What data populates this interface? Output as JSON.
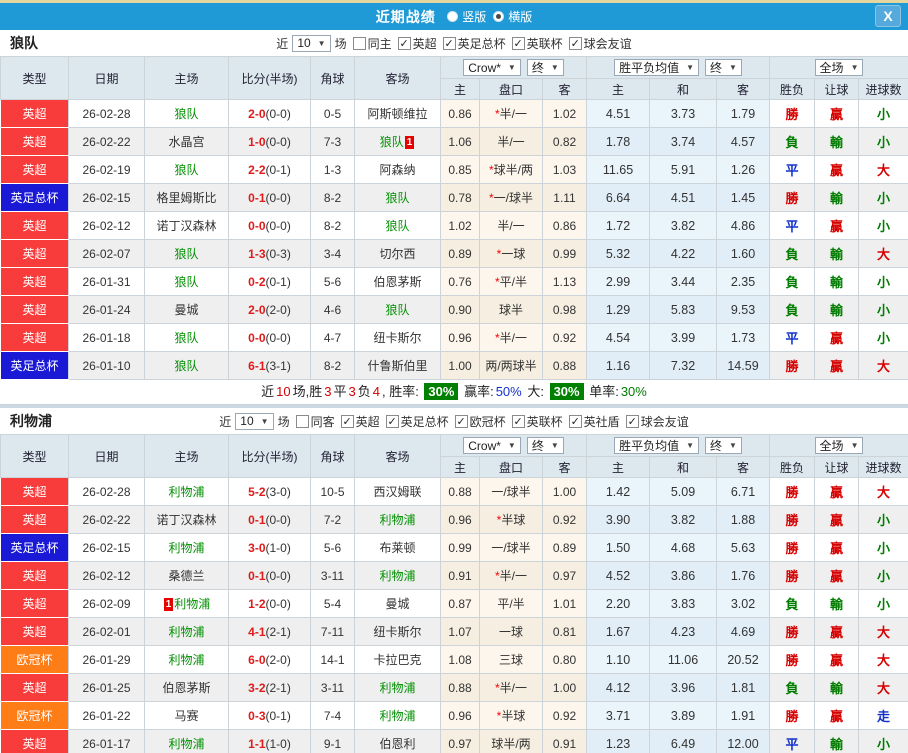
{
  "titlebar": {
    "title": "近期战绩",
    "close": "X",
    "view_options": [
      {
        "label": "竖版",
        "selected": false
      },
      {
        "label": "横版",
        "selected": true
      }
    ]
  },
  "colors": {
    "accent": "#1f9ad6",
    "red": "#d60000",
    "green": "#007d00",
    "blue": "#1130cc",
    "team_green": "#009000",
    "score_red": "#e01b1b",
    "star_red": "#ff0000",
    "badge_green_bg": "#008000",
    "league_epl": "#f83c3c",
    "league_facup": "#1a1ad6",
    "league_ucl": "#ff7d17"
  },
  "table_header": {
    "static_cols": [
      "类型",
      "日期",
      "主场",
      "比分(半场)",
      "角球",
      "客场"
    ],
    "odds_group": {
      "company_select": "Crow*",
      "time_select": "终",
      "sub_cols": [
        "主",
        "盘口",
        "客"
      ]
    },
    "avg_group": {
      "metric_select": "胜平负均值",
      "time_select": "终",
      "sub_cols": [
        "主",
        "和",
        "客"
      ]
    },
    "result_group": {
      "scope_select": "全场",
      "sub_cols": [
        "胜负",
        "让球",
        "进球数"
      ]
    }
  },
  "sections": [
    {
      "team": "狼队",
      "filter": {
        "prefix": "近",
        "count": "10",
        "suffix": "场",
        "same_side": {
          "label": "同主",
          "checked": false
        },
        "leagues": [
          {
            "label": "英超",
            "checked": true
          },
          {
            "label": "英足总杯",
            "checked": true
          },
          {
            "label": "英联杯",
            "checked": true
          },
          {
            "label": "球会友谊",
            "checked": true
          }
        ]
      },
      "rows": [
        {
          "lg": "英超",
          "lgc": "#f83c3c",
          "date": "26-02-28",
          "home": "狼队",
          "hg": true,
          "hcard": "",
          "score": "2-0",
          "half": "(0-0)",
          "cor": "0-5",
          "away": "阿斯顿维拉",
          "ag": false,
          "acard": "",
          "o1": "0.86",
          "star": true,
          "hc": "半/一",
          "o2": "1.02",
          "a1": "4.51",
          "a2": "3.73",
          "a3": "1.79",
          "r1": "勝",
          "c1": "red",
          "r2": "贏",
          "c2": "red",
          "r3": "小",
          "c3": "green"
        },
        {
          "lg": "英超",
          "lgc": "#f83c3c",
          "date": "26-02-22",
          "home": "水晶宫",
          "hg": false,
          "hcard": "",
          "score": "1-0",
          "half": "(0-0)",
          "cor": "7-3",
          "away": "狼队",
          "ag": true,
          "acard": "1",
          "o1": "1.06",
          "star": false,
          "hc": "半/一",
          "o2": "0.82",
          "a1": "1.78",
          "a2": "3.74",
          "a3": "4.57",
          "r1": "負",
          "c1": "green",
          "r2": "輸",
          "c2": "green",
          "r3": "小",
          "c3": "green"
        },
        {
          "lg": "英超",
          "lgc": "#f83c3c",
          "date": "26-02-19",
          "home": "狼队",
          "hg": true,
          "hcard": "",
          "score": "2-2",
          "half": "(0-1)",
          "cor": "1-3",
          "away": "阿森纳",
          "ag": false,
          "acard": "",
          "o1": "0.85",
          "star": true,
          "hc": "球半/两",
          "o2": "1.03",
          "a1": "11.65",
          "a2": "5.91",
          "a3": "1.26",
          "r1": "平",
          "c1": "blue",
          "r2": "贏",
          "c2": "red",
          "r3": "大",
          "c3": "red"
        },
        {
          "lg": "英足总杯",
          "lgc": "#1a1ad6",
          "date": "26-02-15",
          "home": "格里姆斯比",
          "hg": false,
          "hcard": "",
          "score": "0-1",
          "half": "(0-0)",
          "cor": "8-2",
          "away": "狼队",
          "ag": true,
          "acard": "",
          "o1": "0.78",
          "star": true,
          "hc": "一/球半",
          "o2": "1.11",
          "a1": "6.64",
          "a2": "4.51",
          "a3": "1.45",
          "r1": "勝",
          "c1": "red",
          "r2": "輸",
          "c2": "green",
          "r3": "小",
          "c3": "green"
        },
        {
          "lg": "英超",
          "lgc": "#f83c3c",
          "date": "26-02-12",
          "home": "诺丁汉森林",
          "hg": false,
          "hcard": "",
          "score": "0-0",
          "half": "(0-0)",
          "cor": "8-2",
          "away": "狼队",
          "ag": true,
          "acard": "",
          "o1": "1.02",
          "star": false,
          "hc": "半/一",
          "o2": "0.86",
          "a1": "1.72",
          "a2": "3.82",
          "a3": "4.86",
          "r1": "平",
          "c1": "blue",
          "r2": "贏",
          "c2": "red",
          "r3": "小",
          "c3": "green"
        },
        {
          "lg": "英超",
          "lgc": "#f83c3c",
          "date": "26-02-07",
          "home": "狼队",
          "hg": true,
          "hcard": "",
          "score": "1-3",
          "half": "(0-3)",
          "cor": "3-4",
          "away": "切尔西",
          "ag": false,
          "acard": "",
          "o1": "0.89",
          "star": true,
          "hc": "一球",
          "o2": "0.99",
          "a1": "5.32",
          "a2": "4.22",
          "a3": "1.60",
          "r1": "負",
          "c1": "green",
          "r2": "輸",
          "c2": "green",
          "r3": "大",
          "c3": "red"
        },
        {
          "lg": "英超",
          "lgc": "#f83c3c",
          "date": "26-01-31",
          "home": "狼队",
          "hg": true,
          "hcard": "",
          "score": "0-2",
          "half": "(0-1)",
          "cor": "5-6",
          "away": "伯恩茅斯",
          "ag": false,
          "acard": "",
          "o1": "0.76",
          "star": true,
          "hc": "平/半",
          "o2": "1.13",
          "a1": "2.99",
          "a2": "3.44",
          "a3": "2.35",
          "r1": "負",
          "c1": "green",
          "r2": "輸",
          "c2": "green",
          "r3": "小",
          "c3": "green"
        },
        {
          "lg": "英超",
          "lgc": "#f83c3c",
          "date": "26-01-24",
          "home": "曼城",
          "hg": false,
          "hcard": "",
          "score": "2-0",
          "half": "(2-0)",
          "cor": "4-6",
          "away": "狼队",
          "ag": true,
          "acard": "",
          "o1": "0.90",
          "star": false,
          "hc": "球半",
          "o2": "0.98",
          "a1": "1.29",
          "a2": "5.83",
          "a3": "9.53",
          "r1": "負",
          "c1": "green",
          "r2": "輸",
          "c2": "green",
          "r3": "小",
          "c3": "green"
        },
        {
          "lg": "英超",
          "lgc": "#f83c3c",
          "date": "26-01-18",
          "home": "狼队",
          "hg": true,
          "hcard": "",
          "score": "0-0",
          "half": "(0-0)",
          "cor": "4-7",
          "away": "纽卡斯尔",
          "ag": false,
          "acard": "",
          "o1": "0.96",
          "star": true,
          "hc": "半/一",
          "o2": "0.92",
          "a1": "4.54",
          "a2": "3.99",
          "a3": "1.73",
          "r1": "平",
          "c1": "blue",
          "r2": "贏",
          "c2": "red",
          "r3": "小",
          "c3": "green"
        },
        {
          "lg": "英足总杯",
          "lgc": "#1a1ad6",
          "date": "26-01-10",
          "home": "狼队",
          "hg": true,
          "hcard": "",
          "score": "6-1",
          "half": "(3-1)",
          "cor": "8-2",
          "away": "什鲁斯伯里",
          "ag": false,
          "acard": "",
          "o1": "1.00",
          "star": false,
          "hc": "两/两球半",
          "o2": "0.88",
          "a1": "1.16",
          "a2": "7.32",
          "a3": "14.59",
          "r1": "勝",
          "c1": "red",
          "r2": "贏",
          "c2": "red",
          "r3": "大",
          "c3": "red"
        }
      ],
      "summary": [
        {
          "t": "近"
        },
        {
          "t": "10",
          "s": "red"
        },
        {
          "t": "场,胜"
        },
        {
          "t": "3",
          "s": "red"
        },
        {
          "t": "平"
        },
        {
          "t": "3",
          "s": "red"
        },
        {
          "t": "负"
        },
        {
          "t": "4",
          "s": "red"
        },
        {
          "t": ", 胜率: "
        },
        {
          "t": "30%",
          "s": "badge"
        },
        {
          "t": " 赢率:"
        },
        {
          "t": "50%",
          "s": "blue"
        },
        {
          "t": " 大: "
        },
        {
          "t": "30%",
          "s": "badge"
        },
        {
          "t": " 单率:"
        },
        {
          "t": "30%",
          "s": "green"
        }
      ]
    },
    {
      "team": "利物浦",
      "filter": {
        "prefix": "近",
        "count": "10",
        "suffix": "场",
        "same_side": {
          "label": "同客",
          "checked": false
        },
        "leagues": [
          {
            "label": "英超",
            "checked": true
          },
          {
            "label": "英足总杯",
            "checked": true
          },
          {
            "label": "欧冠杯",
            "checked": true
          },
          {
            "label": "英联杯",
            "checked": true
          },
          {
            "label": "英社盾",
            "checked": true
          },
          {
            "label": "球会友谊",
            "checked": true
          }
        ]
      },
      "rows": [
        {
          "lg": "英超",
          "lgc": "#f83c3c",
          "date": "26-02-28",
          "home": "利物浦",
          "hg": true,
          "hcard": "",
          "score": "5-2",
          "half": "(3-0)",
          "cor": "10-5",
          "away": "西汉姆联",
          "ag": false,
          "acard": "",
          "o1": "0.88",
          "star": false,
          "hc": "一/球半",
          "o2": "1.00",
          "a1": "1.42",
          "a2": "5.09",
          "a3": "6.71",
          "r1": "勝",
          "c1": "red",
          "r2": "贏",
          "c2": "red",
          "r3": "大",
          "c3": "red"
        },
        {
          "lg": "英超",
          "lgc": "#f83c3c",
          "date": "26-02-22",
          "home": "诺丁汉森林",
          "hg": false,
          "hcard": "",
          "score": "0-1",
          "half": "(0-0)",
          "cor": "7-2",
          "away": "利物浦",
          "ag": true,
          "acard": "",
          "o1": "0.96",
          "star": true,
          "hc": "半球",
          "o2": "0.92",
          "a1": "3.90",
          "a2": "3.82",
          "a3": "1.88",
          "r1": "勝",
          "c1": "red",
          "r2": "贏",
          "c2": "red",
          "r3": "小",
          "c3": "green"
        },
        {
          "lg": "英足总杯",
          "lgc": "#1a1ad6",
          "date": "26-02-15",
          "home": "利物浦",
          "hg": true,
          "hcard": "",
          "score": "3-0",
          "half": "(1-0)",
          "cor": "5-6",
          "away": "布莱顿",
          "ag": false,
          "acard": "",
          "o1": "0.99",
          "star": false,
          "hc": "一/球半",
          "o2": "0.89",
          "a1": "1.50",
          "a2": "4.68",
          "a3": "5.63",
          "r1": "勝",
          "c1": "red",
          "r2": "贏",
          "c2": "red",
          "r3": "小",
          "c3": "green"
        },
        {
          "lg": "英超",
          "lgc": "#f83c3c",
          "date": "26-02-12",
          "home": "桑德兰",
          "hg": false,
          "hcard": "",
          "score": "0-1",
          "half": "(0-0)",
          "cor": "3-11",
          "away": "利物浦",
          "ag": true,
          "acard": "",
          "o1": "0.91",
          "star": true,
          "hc": "半/一",
          "o2": "0.97",
          "a1": "4.52",
          "a2": "3.86",
          "a3": "1.76",
          "r1": "勝",
          "c1": "red",
          "r2": "贏",
          "c2": "red",
          "r3": "小",
          "c3": "green"
        },
        {
          "lg": "英超",
          "lgc": "#f83c3c",
          "date": "26-02-09",
          "home": "利物浦",
          "hg": true,
          "hcard": "1",
          "score": "1-2",
          "half": "(0-0)",
          "cor": "5-4",
          "away": "曼城",
          "ag": false,
          "acard": "",
          "o1": "0.87",
          "star": false,
          "hc": "平/半",
          "o2": "1.01",
          "a1": "2.20",
          "a2": "3.83",
          "a3": "3.02",
          "r1": "負",
          "c1": "green",
          "r2": "輸",
          "c2": "green",
          "r3": "小",
          "c3": "green"
        },
        {
          "lg": "英超",
          "lgc": "#f83c3c",
          "date": "26-02-01",
          "home": "利物浦",
          "hg": true,
          "hcard": "",
          "score": "4-1",
          "half": "(2-1)",
          "cor": "7-11",
          "away": "纽卡斯尔",
          "ag": false,
          "acard": "",
          "o1": "1.07",
          "star": false,
          "hc": "一球",
          "o2": "0.81",
          "a1": "1.67",
          "a2": "4.23",
          "a3": "4.69",
          "r1": "勝",
          "c1": "red",
          "r2": "贏",
          "c2": "red",
          "r3": "大",
          "c3": "red"
        },
        {
          "lg": "欧冠杯",
          "lgc": "#ff7d17",
          "date": "26-01-29",
          "home": "利物浦",
          "hg": true,
          "hcard": "",
          "score": "6-0",
          "half": "(2-0)",
          "cor": "14-1",
          "away": "卡拉巴克",
          "ag": false,
          "acard": "",
          "o1": "1.08",
          "star": false,
          "hc": "三球",
          "o2": "0.80",
          "a1": "1.10",
          "a2": "11.06",
          "a3": "20.52",
          "r1": "勝",
          "c1": "red",
          "r2": "贏",
          "c2": "red",
          "r3": "大",
          "c3": "red"
        },
        {
          "lg": "英超",
          "lgc": "#f83c3c",
          "date": "26-01-25",
          "home": "伯恩茅斯",
          "hg": false,
          "hcard": "",
          "score": "3-2",
          "half": "(2-1)",
          "cor": "3-11",
          "away": "利物浦",
          "ag": true,
          "acard": "",
          "o1": "0.88",
          "star": true,
          "hc": "半/一",
          "o2": "1.00",
          "a1": "4.12",
          "a2": "3.96",
          "a3": "1.81",
          "r1": "負",
          "c1": "green",
          "r2": "輸",
          "c2": "green",
          "r3": "大",
          "c3": "red"
        },
        {
          "lg": "欧冠杯",
          "lgc": "#ff7d17",
          "date": "26-01-22",
          "home": "马赛",
          "hg": false,
          "hcard": "",
          "score": "0-3",
          "half": "(0-1)",
          "cor": "7-4",
          "away": "利物浦",
          "ag": true,
          "acard": "",
          "o1": "0.96",
          "star": true,
          "hc": "半球",
          "o2": "0.92",
          "a1": "3.71",
          "a2": "3.89",
          "a3": "1.91",
          "r1": "勝",
          "c1": "red",
          "r2": "贏",
          "c2": "red",
          "r3": "走",
          "c3": "blue"
        },
        {
          "lg": "英超",
          "lgc": "#f83c3c",
          "date": "26-01-17",
          "home": "利物浦",
          "hg": true,
          "hcard": "",
          "score": "1-1",
          "half": "(1-0)",
          "cor": "9-1",
          "away": "伯恩利",
          "ag": false,
          "acard": "",
          "o1": "0.97",
          "star": false,
          "hc": "球半/两",
          "o2": "0.91",
          "a1": "1.23",
          "a2": "6.49",
          "a3": "12.00",
          "r1": "平",
          "c1": "blue",
          "r2": "輸",
          "c2": "green",
          "r3": "小",
          "c3": "green"
        }
      ],
      "summary": null
    }
  ]
}
